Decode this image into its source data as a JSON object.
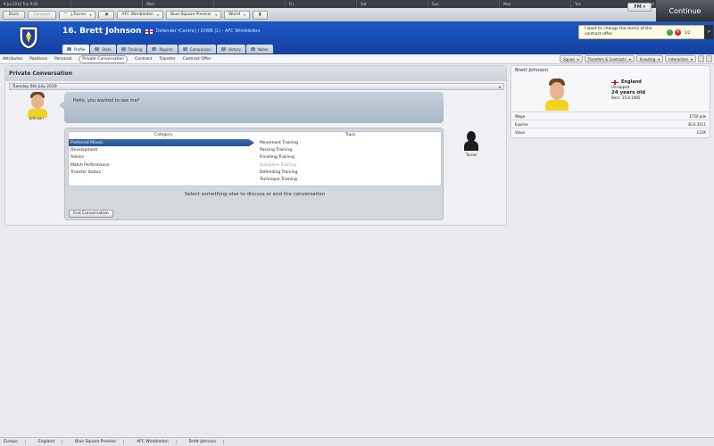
{
  "topbar": {
    "cells": [
      "8 Jul 2010 Tue 9:00",
      "",
      "Wed",
      "",
      "Fri",
      "Sat",
      "Sun",
      "Mon",
      "Tue",
      "Wed"
    ]
  },
  "nav": {
    "back": "Back",
    "forward": "Forward",
    "manager": "J.Turner",
    "club": "AFC Wimbledon",
    "league": "Blue Square Premier",
    "world": "World",
    "fm": "FM",
    "continue": "Continue"
  },
  "player": {
    "number_name": "16. Brett Johnson",
    "position_club": "Defender (Centre) / D/WB (L) - AFC Wimbledon"
  },
  "tabs": [
    "Profile",
    "Stats",
    "Training",
    "Reports",
    "Comparison",
    "History",
    "Notes"
  ],
  "notification": {
    "message": "I want to change the terms of the contract offer.",
    "count": "1/2"
  },
  "subnav": {
    "items": [
      "Attributes",
      "Positions",
      "Personal",
      "Private Conversation",
      "Contract",
      "Transfer",
      "Contract Offer"
    ],
    "menus": [
      "Squad",
      "Transfers & Contracts",
      "Scouting",
      "Interaction"
    ]
  },
  "conversation": {
    "title": "Private Conversation",
    "date": "Tuesday 6th July 2010",
    "player_label": "Johnson",
    "player_message": "Hello, you wanted to see me?",
    "manager_label": "Turner",
    "category_header": "Category",
    "topic_header": "Topic",
    "categories": [
      "Preferred Moves",
      "Development",
      "Advice",
      "Match Performance",
      "Transfer Status"
    ],
    "topics": [
      "Movement Training",
      "Passing Training",
      "Finishing Training",
      "Discipline Training",
      "Defending Training",
      "Technique Training"
    ],
    "select_message": "Select something else to discuss or end the conversation",
    "end_button": "End Conversation"
  },
  "profile": {
    "name": "Brett Johnson",
    "nation": "England",
    "caps": "Uncapped",
    "age": "24 years old",
    "born": "Born: 15.8.1985",
    "stats": [
      {
        "label": "Wage",
        "value": "£750 p/w"
      },
      {
        "label": "Expires",
        "value": "30.6.2011"
      },
      {
        "label": "Value",
        "value": "£12K"
      }
    ]
  },
  "breadcrumbs": [
    "Europe",
    "England",
    "Blue Square Premier",
    "AFC Wimbledon",
    "Brett Johnson"
  ]
}
